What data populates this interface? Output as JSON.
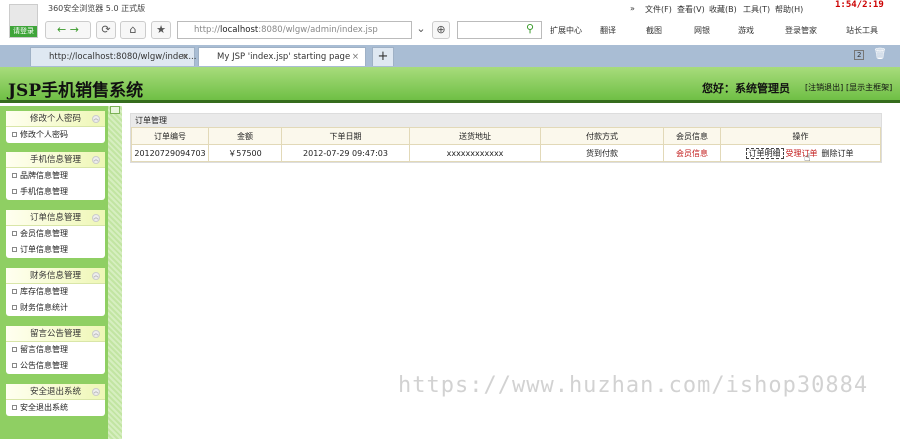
{
  "browser": {
    "app_title": "360安全浏览器 5.0 正式版",
    "login_label": "请登录",
    "url_prefix": "http://",
    "url_host": "localhost",
    "url_rest": ":8080/wlgw/admin/index.jsp",
    "menu": [
      "»",
      "文件(F)",
      "查看(V)",
      "收藏(B)",
      "工具(T)",
      "帮助(H)"
    ],
    "clock": "1:54/2:19",
    "tools": [
      "扩展中心",
      "翻译",
      "截图",
      "网银",
      "游戏",
      "登录管家",
      "站长工具"
    ],
    "tabs": [
      {
        "label": "http://localhost:8080/wlgw/index...",
        "close": "×"
      },
      {
        "label": "My JSP 'index.jsp' starting page",
        "close": "×"
      }
    ],
    "new_tab": "+",
    "tab_count": "2"
  },
  "header": {
    "logo": "JSP手机销售系统",
    "greeting": "您好：系统管理员",
    "logout": "[注销退出]",
    "show_frame": "[显示主框架]"
  },
  "sidebar": [
    {
      "title": "修改个人密码",
      "items": [
        "修改个人密码"
      ]
    },
    {
      "title": "手机信息管理",
      "items": [
        "品牌信息管理",
        "手机信息管理"
      ]
    },
    {
      "title": "订单信息管理",
      "items": [
        "会员信息管理",
        "订单信息管理"
      ]
    },
    {
      "title": "财务信息管理",
      "items": [
        "库存信息管理",
        "财务信息统计"
      ]
    },
    {
      "title": "留言公告管理",
      "items": [
        "留言信息管理",
        "公告信息管理"
      ]
    },
    {
      "title": "安全退出系统",
      "items": [
        "安全退出系统"
      ]
    }
  ],
  "main": {
    "title": "订单管理",
    "columns": [
      "订单编号",
      "金额",
      "下单日期",
      "送货地址",
      "付款方式",
      "会员信息",
      "操作"
    ],
    "rows": [
      {
        "id": "20120729094703",
        "amount": "￥57500",
        "date": "2012-07-29 09:47:03",
        "address": "xxxxxxxxxxxx",
        "payment": "货到付款",
        "member": "会员信息",
        "ops": [
          "订单明细",
          "受理订单",
          "删除订单"
        ]
      }
    ]
  },
  "watermark": "https://www.huzhan.com/ishop30884"
}
